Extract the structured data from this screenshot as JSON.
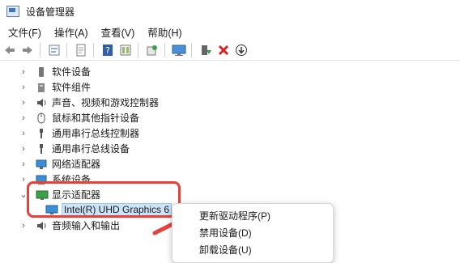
{
  "window": {
    "title": "设备管理器",
    "icon": "device-manager-icon"
  },
  "menubar": {
    "items": [
      "文件(F)",
      "操作(A)",
      "查看(V)",
      "帮助(H)"
    ]
  },
  "toolbar": {
    "buttons": [
      "back-arrow-icon",
      "forward-arrow-icon",
      "properties-icon",
      "help-doc-icon",
      "help-icon",
      "show-hidden-icon",
      "scan-hardware-icon",
      "monitor-icon",
      "update-driver-icon",
      "uninstall-icon",
      "disable-icon"
    ],
    "colors": {
      "green": "#2f9e44",
      "red": "#d62222"
    }
  },
  "tree": {
    "items": [
      {
        "label": "软件设备",
        "icon": "software-device-icon",
        "expanded": false
      },
      {
        "label": "软件组件",
        "icon": "software-component-icon",
        "expanded": false
      },
      {
        "label": "声音、视频和游戏控制器",
        "icon": "speaker-icon",
        "expanded": false
      },
      {
        "label": "鼠标和其他指针设备",
        "icon": "mouse-icon",
        "expanded": false
      },
      {
        "label": "通用串行总线控制器",
        "icon": "usb-icon",
        "expanded": false
      },
      {
        "label": "通用串行总线设备",
        "icon": "usb-icon",
        "expanded": false
      },
      {
        "label": "网络适配器",
        "icon": "network-adapter-icon",
        "expanded": false
      },
      {
        "label": "系统设备",
        "icon": "system-device-icon",
        "expanded": false
      },
      {
        "label": "显示适配器",
        "icon": "display-adapter-icon",
        "expanded": true
      },
      {
        "label": "Intel(R) UHD Graphics 6",
        "icon": "display-adapter-icon",
        "child": true,
        "selected": true
      },
      {
        "label": "音频输入和输出",
        "icon": "speaker-icon",
        "expanded": false
      }
    ]
  },
  "context_menu": {
    "items": [
      "更新驱动程序(P)",
      "禁用设备(D)",
      "卸载设备(U)"
    ]
  },
  "annotation": {
    "color": "#e8413a"
  }
}
